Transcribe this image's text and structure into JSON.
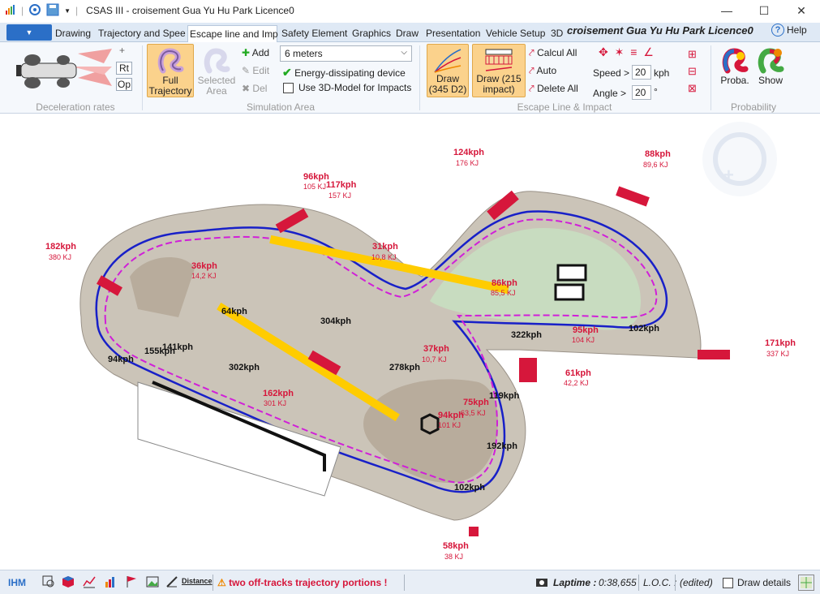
{
  "window": {
    "title": "CSAS III - croisement Gua Yu Hu Park Licence0",
    "minimize_icon": "minimize-icon",
    "maximize_icon": "maximize-icon",
    "close_icon": "close-icon"
  },
  "tabs": [
    {
      "label": "Drawing"
    },
    {
      "label": "Trajectory and Spee"
    },
    {
      "label": "Escape line and Imp"
    },
    {
      "label": "Safety Element"
    },
    {
      "label": "Graphics"
    },
    {
      "label": "Draw"
    },
    {
      "label": "Presentation"
    },
    {
      "label": "Vehicle Setup"
    },
    {
      "label": "3D"
    }
  ],
  "active_tab": "Escape line and Imp",
  "document_title": "croisement Gua Yu Hu Park Licence0",
  "help_label": "Help",
  "ribbon": {
    "deceleration": {
      "group_label": "Deceleration rates",
      "plus_label": "+",
      "rt_label": "Rt",
      "op_label": "Op"
    },
    "simulation_area": {
      "group_label": "Simulation Area",
      "full_trajectory_label": "Full\nTrajectory",
      "selected_area_label": "Selected\nArea",
      "add_label": "Add",
      "edit_label": "Edit",
      "del_label": "Del",
      "distance_select": "6 meters",
      "energy_device_label": "Energy-dissipating device",
      "energy_device_checked": true,
      "use_3d_label": "Use 3D-Model for Impacts",
      "use_3d_checked": false
    },
    "escape_line": {
      "group_label": "Escape Line & Impact",
      "draw_d2_label": "Draw\n(345 D2)",
      "draw_impact_label": "Draw  (215\nimpact)",
      "calcul_all_label": "Calcul All",
      "auto_label": "Auto",
      "delete_all_label": "Delete All",
      "speed_label": "Speed >",
      "speed_value": "20",
      "speed_unit": "kph",
      "angle_label": "Angle >",
      "angle_value": "20",
      "angle_unit": "°"
    },
    "probability": {
      "group_label": "Probability",
      "proba_label": "Proba.",
      "show_label": "Show"
    }
  },
  "track_labels": {
    "speeds_black": [
      "304kph",
      "64kph",
      "155kph",
      "141kph",
      "94kph",
      "302kph",
      "278kph",
      "322kph",
      "102kph",
      "119kph",
      "192kph",
      "102kph"
    ],
    "impacts": [
      {
        "speed": "182kph",
        "energy": "380 KJ"
      },
      {
        "speed": "36kph",
        "energy": "14,2 KJ"
      },
      {
        "speed": "96kph",
        "energy": "105 KJ"
      },
      {
        "speed": "117kph",
        "energy": "157 KJ"
      },
      {
        "speed": "124kph",
        "energy": "176 KJ"
      },
      {
        "speed": "88kph",
        "energy": "89,6 KJ"
      },
      {
        "speed": "31kph",
        "energy": "10,8 KJ"
      },
      {
        "speed": "86kph",
        "energy": "85,5 KJ"
      },
      {
        "speed": "95kph",
        "energy": "104 KJ"
      },
      {
        "speed": "171kph",
        "energy": "337 KJ"
      },
      {
        "speed": "37kph",
        "energy": "10,7 KJ"
      },
      {
        "speed": "61kph",
        "energy": "42,2 KJ"
      },
      {
        "speed": "162kph",
        "energy": "301 KJ"
      },
      {
        "speed": "75kph",
        "energy": "63,5 KJ"
      },
      {
        "speed": "94kph",
        "energy": "101 KJ"
      },
      {
        "speed": "58kph",
        "energy": "38 KJ"
      }
    ]
  },
  "statusbar": {
    "ihm_label": "IHM",
    "distance_label": "Distance",
    "warning_text": "two off-tracks trajectory portions !",
    "laptime_label": "Laptime :",
    "laptime_value": "0:38,655",
    "loc_label": "L.O.C. :",
    "edited_label": "(edited)",
    "draw_details_label": "Draw details",
    "draw_details_checked": false
  },
  "colors": {
    "accent": "#2b6fc7",
    "impact_red": "#d6173b",
    "track_blue": "#1820c8",
    "magenta": "#d020d8",
    "kerb_yellow": "#ffcc00",
    "gravel": "#c9bfae",
    "grass": "#c8dcc0"
  }
}
